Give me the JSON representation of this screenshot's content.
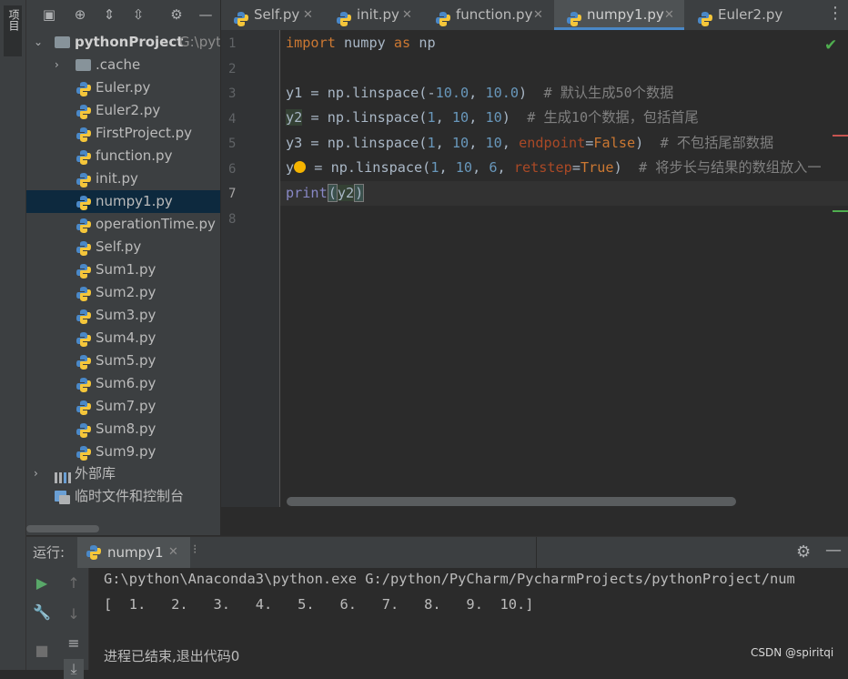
{
  "left_strip": {
    "tab_label": "项目"
  },
  "project": {
    "root_name": "pythonProject",
    "root_path": "G:\\pyt",
    "items": [
      {
        "label": ".cache",
        "type": "folder"
      },
      {
        "label": "Euler.py",
        "type": "py"
      },
      {
        "label": "Euler2.py",
        "type": "py"
      },
      {
        "label": "FirstProject.py",
        "type": "py"
      },
      {
        "label": "function.py",
        "type": "py"
      },
      {
        "label": "init.py",
        "type": "py"
      },
      {
        "label": "numpy1.py",
        "type": "py",
        "selected": true
      },
      {
        "label": "operationTime.py",
        "type": "py"
      },
      {
        "label": "Self.py",
        "type": "py"
      },
      {
        "label": "Sum1.py",
        "type": "py"
      },
      {
        "label": "Sum2.py",
        "type": "py"
      },
      {
        "label": "Sum3.py",
        "type": "py"
      },
      {
        "label": "Sum4.py",
        "type": "py"
      },
      {
        "label": "Sum5.py",
        "type": "py"
      },
      {
        "label": "Sum6.py",
        "type": "py"
      },
      {
        "label": "Sum7.py",
        "type": "py"
      },
      {
        "label": "Sum8.py",
        "type": "py"
      },
      {
        "label": "Sum9.py",
        "type": "py"
      }
    ],
    "external_libs": "外部库",
    "scratches": "临时文件和控制台"
  },
  "tabs": [
    {
      "label": "Self.py"
    },
    {
      "label": "init.py"
    },
    {
      "label": "function.py"
    },
    {
      "label": "numpy1.py",
      "active": true
    },
    {
      "label": "Euler2.py"
    }
  ],
  "editor": {
    "line_numbers": [
      "1",
      "2",
      "3",
      "4",
      "5",
      "6",
      "7",
      "8"
    ],
    "current_line": 7
  },
  "run": {
    "label": "运行:",
    "tab_name": "numpy1",
    "console": {
      "line1": "G:\\python\\Anaconda3\\python.exe G:/python/PyCharm/PycharmProjects/pythonProject/num",
      "line2": "[  1.   2.   3.   4.   5.   6.   7.   8.   9.  10.]",
      "line3": "进程已结束,退出代码0"
    }
  },
  "watermark": "CSDN @spiritqi",
  "icons": {
    "python_file": "python-file-icon",
    "folder": "folder-icon",
    "library": "library-icon",
    "scratch": "scratch-icon"
  },
  "colors": {
    "background": "#2b2b2b",
    "panel": "#3c3f41",
    "keyword": "#cc7832",
    "number": "#6897bb",
    "comment": "#808080",
    "param": "#aa4926",
    "builtin": "#8888c6",
    "selection": "#0d293e",
    "tab_underline": "#4a88c7"
  }
}
